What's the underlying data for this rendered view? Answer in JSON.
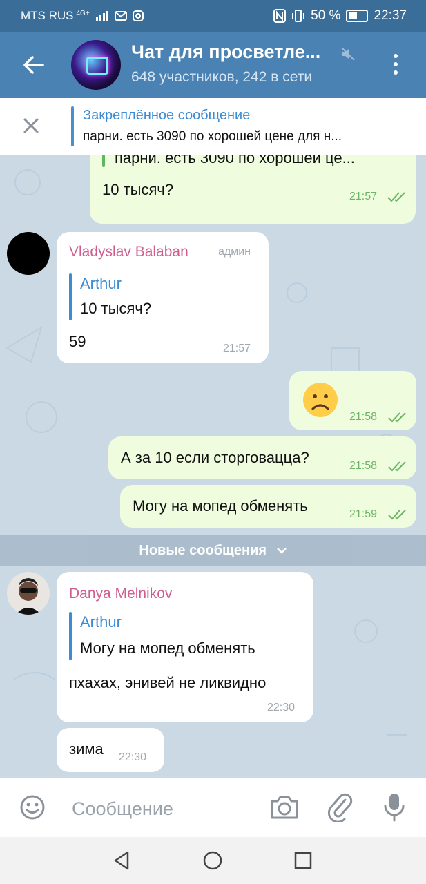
{
  "status_bar": {
    "carrier": "MTS RUS",
    "network": "4G+",
    "battery": "50 %",
    "time": "22:37"
  },
  "header": {
    "title": "Чат для просветле...",
    "subtitle": "648 участников, 242 в сети"
  },
  "pinned": {
    "title": "Закреплённое сообщение",
    "text": "парни.  есть 3090 по хорошей цене для н..."
  },
  "messages": {
    "m1": {
      "quote_text": "парни.  есть 3090 по хорошей це...",
      "text": "10 тысяч?",
      "time": "21:57"
    },
    "m2": {
      "sender": "Vladyslav Balaban",
      "role": "админ",
      "quote_name": "Arthur",
      "quote_text": "10 тысяч?",
      "text": "59",
      "time": "21:57"
    },
    "m3": {
      "text": "☹",
      "time": "21:58"
    },
    "m4": {
      "text": "А за 10 если сторговацца?",
      "time": "21:58"
    },
    "m5": {
      "text": "Могу на мопед обменять",
      "time": "21:59"
    },
    "new_messages": "Новые сообщения",
    "m6": {
      "sender": "Danya Melnikov",
      "quote_name": "Arthur",
      "quote_text": "Могу на мопед обменять",
      "text": "пхахах, энивей не ликвидно",
      "time": "22:30"
    },
    "m7": {
      "text": "зима",
      "time": "22:30"
    }
  },
  "input": {
    "placeholder": "Сообщение"
  },
  "colors": {
    "header": "#4a82b3",
    "status": "#3a6e99",
    "accent": "#3d8bd0",
    "outgoing": "#effdde",
    "sender": "#cf5d8f"
  }
}
